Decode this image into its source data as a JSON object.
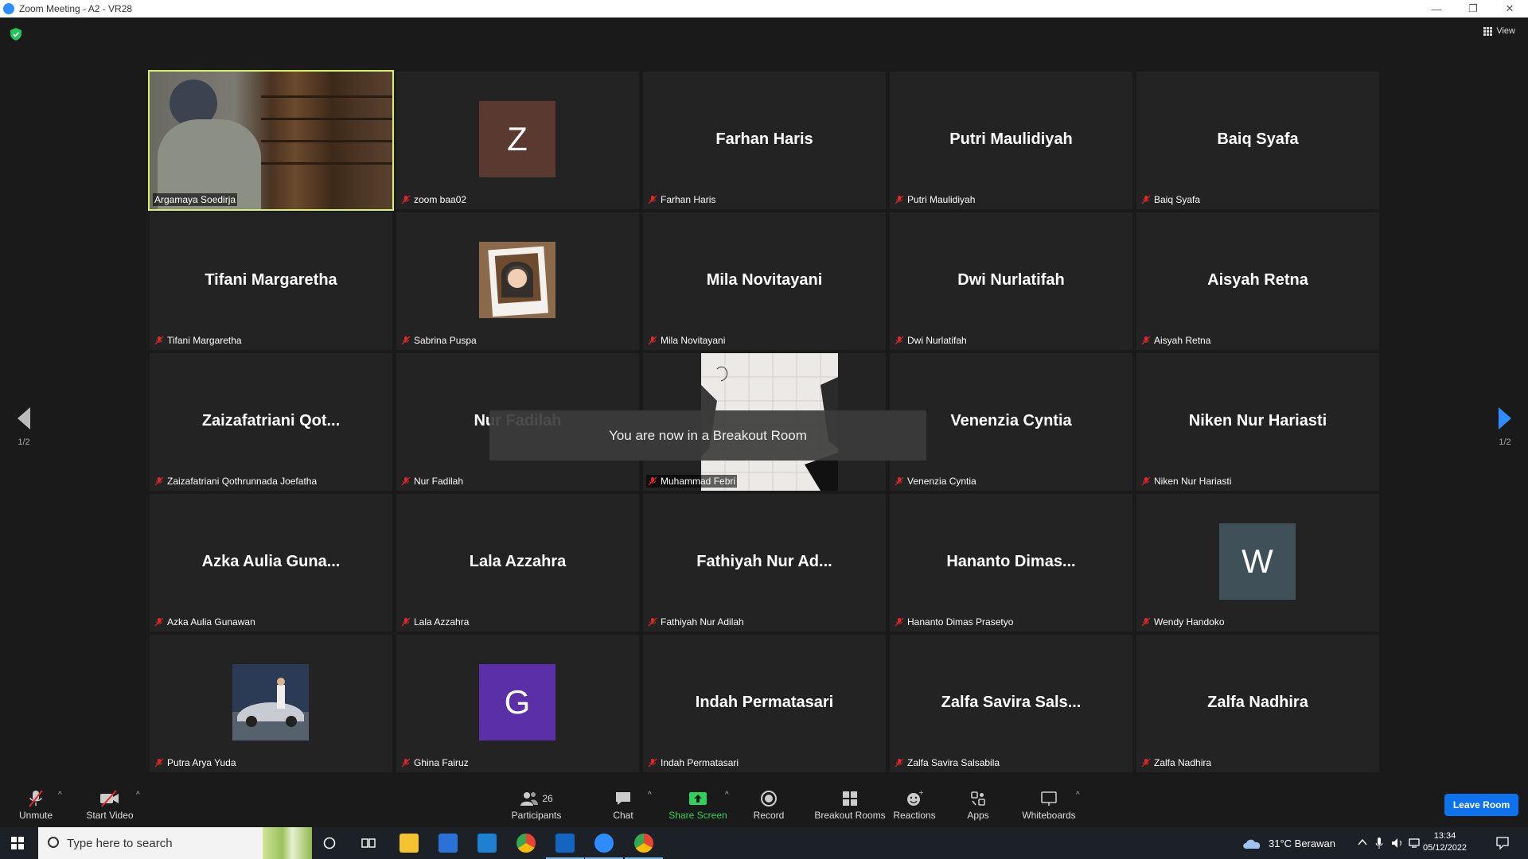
{
  "window": {
    "title": "Zoom Meeting - A2 - VR28"
  },
  "topbar": {
    "view_label": "View"
  },
  "nav": {
    "left_page": "1/2",
    "right_page": "1/2"
  },
  "tiles": [
    {
      "display": "video",
      "label": "Argamaya Soedirja",
      "active": true
    },
    {
      "display": "avatar",
      "avatar_letter": "Z",
      "avatar_color": "#5a3a30",
      "label": "zoom baa02"
    },
    {
      "display": "name",
      "big_name": "Farhan Haris",
      "label": "Farhan Haris"
    },
    {
      "display": "name",
      "big_name": "Putri Maulidiyah",
      "label": "Putri Maulidiyah"
    },
    {
      "display": "name",
      "big_name": "Baiq Syafa",
      "label": "Baiq Syafa"
    },
    {
      "display": "name",
      "big_name": "Tifani Margaretha",
      "label": "Tifani Margaretha"
    },
    {
      "display": "photo",
      "photo": "portrait",
      "label": "Sabrina Puspa"
    },
    {
      "display": "name",
      "big_name": "Mila Novitayani",
      "label": "Mila Novitayani"
    },
    {
      "display": "name",
      "big_name": "Dwi Nurlatifah",
      "label": "Dwi Nurlatifah"
    },
    {
      "display": "name",
      "big_name": "Aisyah Retna",
      "label": "Aisyah Retna"
    },
    {
      "display": "name",
      "big_name": "Zaizafatriani Qot...",
      "label": "Zaizafatriani Qothrunnada Joefatha"
    },
    {
      "display": "name",
      "big_name": "Nur Fadilah",
      "label": "Nur Fadilah"
    },
    {
      "display": "photo",
      "photo": "sketch",
      "label": "Muhammad Febri"
    },
    {
      "display": "name",
      "big_name": "Venenzia Cyntia",
      "label": "Venenzia Cyntia"
    },
    {
      "display": "name",
      "big_name": "Niken Nur Hariasti",
      "label": "Niken Nur Hariasti"
    },
    {
      "display": "name",
      "big_name": "Azka Aulia Guna...",
      "label": "Azka Aulia Gunawan"
    },
    {
      "display": "name",
      "big_name": "Lala Azzahra",
      "label": "Lala Azzahra"
    },
    {
      "display": "name",
      "big_name": "Fathiyah Nur Ad...",
      "label": "Fathiyah Nur Adilah"
    },
    {
      "display": "name",
      "big_name": "Hananto Dimas...",
      "label": "Hananto Dimas Prasetyo"
    },
    {
      "display": "avatar",
      "avatar_letter": "W",
      "avatar_color": "#3f5058",
      "label": "Wendy Handoko"
    },
    {
      "display": "photo",
      "photo": "car",
      "label": "Putra Arya Yuda"
    },
    {
      "display": "avatar",
      "avatar_letter": "G",
      "avatar_color": "#5b2fa8",
      "label": "Ghina Fairuz"
    },
    {
      "display": "name",
      "big_name": "Indah Permatasari",
      "label": "Indah Permatasari"
    },
    {
      "display": "name",
      "big_name": "Zalfa Savira Sals...",
      "label": "Zalfa Savira Salsabila"
    },
    {
      "display": "name",
      "big_name": "Zalfa Nadhira",
      "label": "Zalfa Nadhira"
    }
  ],
  "toast": "You are now in a Breakout Room",
  "toolbar": {
    "unmute": "Unmute",
    "start_video": "Start Video",
    "participants": "Participants",
    "participants_count": "26",
    "chat": "Chat",
    "share_screen": "Share Screen",
    "record": "Record",
    "breakout_rooms": "Breakout Rooms",
    "reactions": "Reactions",
    "apps": "Apps",
    "whiteboards": "Whiteboards",
    "leave": "Leave Room"
  },
  "taskbar": {
    "search_placeholder": "Type here to search",
    "weather": "31°C  Berawan",
    "time": "13:34",
    "date": "05/12/2022"
  }
}
